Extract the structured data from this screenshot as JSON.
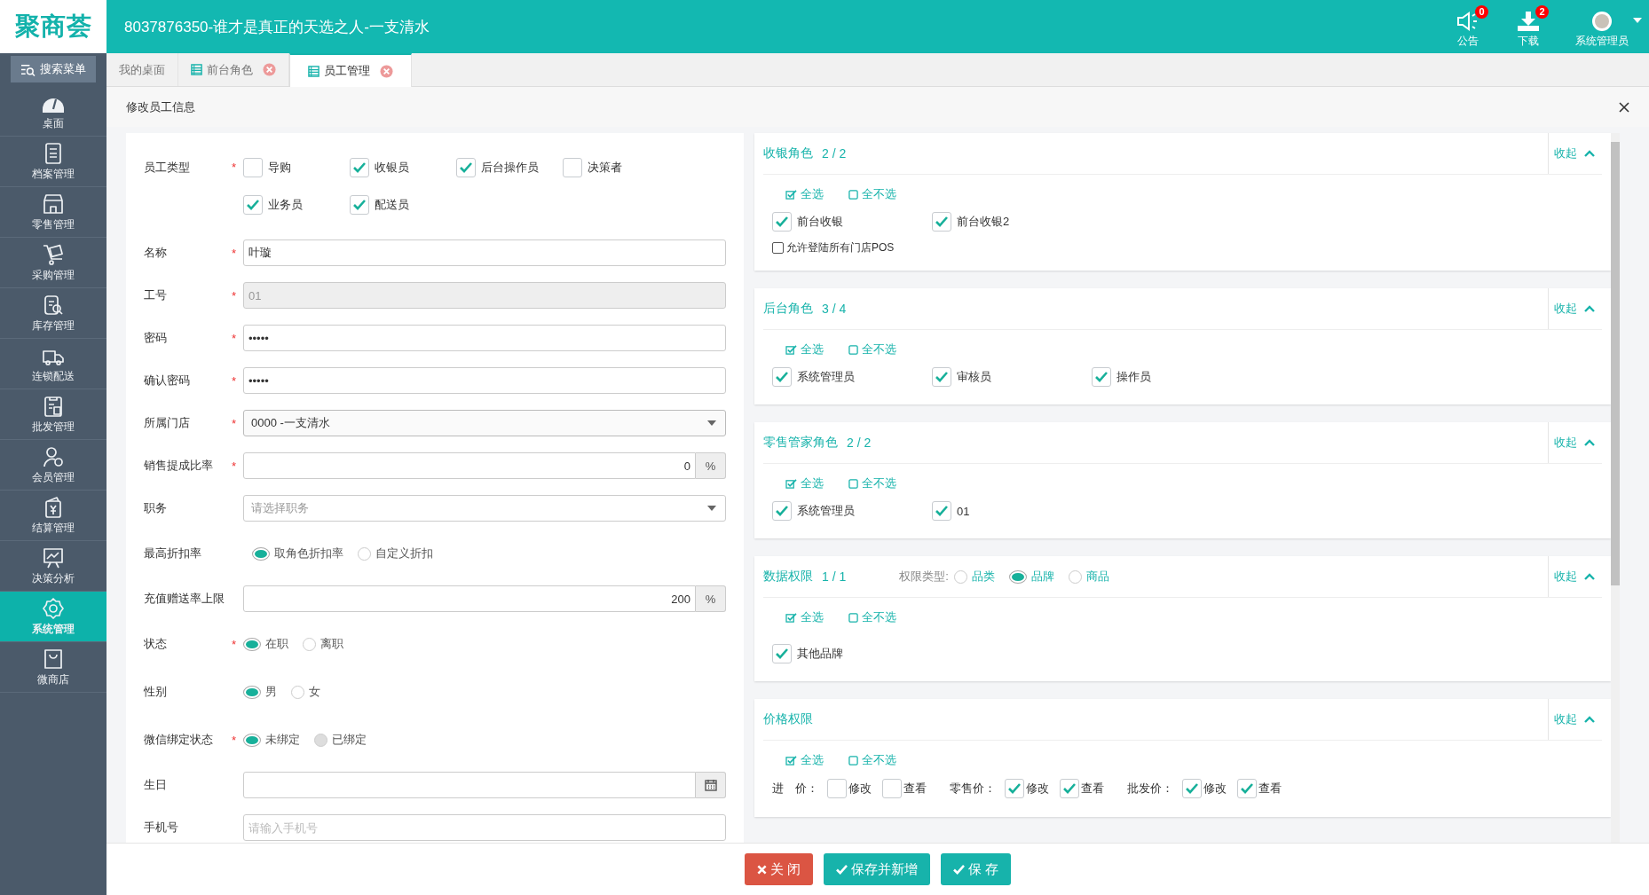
{
  "header": {
    "logo": "聚商荟",
    "title": "8037876350-谁才是真正的天选之人-一支清水",
    "actions": [
      {
        "label": "公告",
        "badge": "0"
      },
      {
        "label": "下载",
        "badge": "2"
      },
      {
        "label": "系统管理员"
      }
    ]
  },
  "sidebar": {
    "search": "搜索菜单",
    "items": [
      {
        "label": "桌面",
        "selected": false
      },
      {
        "label": "档案管理",
        "selected": false
      },
      {
        "label": "零售管理",
        "selected": false
      },
      {
        "label": "采购管理",
        "selected": false
      },
      {
        "label": "库存管理",
        "selected": false
      },
      {
        "label": "连锁配送",
        "selected": false
      },
      {
        "label": "批发管理",
        "selected": false
      },
      {
        "label": "会员管理",
        "selected": false
      },
      {
        "label": "结算管理",
        "selected": false
      },
      {
        "label": "决策分析",
        "selected": false
      },
      {
        "label": "系统管理",
        "selected": true
      },
      {
        "label": "微商店",
        "selected": false
      }
    ]
  },
  "tabs": [
    {
      "label": "我的桌面",
      "selected": false,
      "closable": false
    },
    {
      "label": "前台角色",
      "selected": false,
      "closable": true
    },
    {
      "label": "员工管理",
      "selected": true,
      "closable": true
    }
  ],
  "panel": {
    "title": "修改员工信息"
  },
  "form": {
    "fields": [
      {
        "kind": "checkboxes",
        "label": "员工类型",
        "required_mark": "*",
        "options": [
          {
            "label": "导购",
            "checked": false
          },
          {
            "label": "收银员",
            "checked": true
          },
          {
            "label": "后台操作员",
            "checked": true
          },
          {
            "label": "决策者",
            "checked": false
          },
          {
            "label": "业务员",
            "checked": true
          },
          {
            "label": "配送员",
            "checked": true
          }
        ]
      },
      {
        "kind": "text",
        "label": "名称",
        "required_mark": "*",
        "value": "叶璇",
        "disabled": false
      },
      {
        "kind": "text",
        "label": "工号",
        "required_mark": "*",
        "value": "01",
        "disabled": true
      },
      {
        "kind": "text",
        "label": "密码",
        "required_mark": "*",
        "value": "•••••",
        "disabled": false
      },
      {
        "kind": "text",
        "label": "确认密码",
        "required_mark": "*",
        "value": "•••••",
        "disabled": false
      },
      {
        "kind": "select",
        "label": "所属门店",
        "required_mark": "*",
        "value": "0000 -一支清水"
      },
      {
        "kind": "addon",
        "label": "销售提成比率",
        "required_mark": "*",
        "value": "0",
        "addon": "%"
      },
      {
        "kind": "select",
        "label": "职务",
        "placeholder": "请选择职务"
      },
      {
        "kind": "radios",
        "label": "最高折扣率",
        "options": [
          {
            "label": "取角色折扣率",
            "selected": true,
            "disabled": false
          },
          {
            "label": "自定义折扣",
            "selected": false,
            "disabled": false
          }
        ]
      },
      {
        "kind": "addon",
        "label": "充值赠送率上限",
        "value": "200",
        "addon": "%"
      },
      {
        "kind": "radios",
        "label": "状态",
        "required_mark": "*",
        "options": [
          {
            "label": "在职",
            "selected": true,
            "disabled": false
          },
          {
            "label": "离职",
            "selected": false,
            "disabled": false
          }
        ]
      },
      {
        "kind": "radios",
        "label": "性别",
        "options": [
          {
            "label": "男",
            "selected": true,
            "disabled": false
          },
          {
            "label": "女",
            "selected": false,
            "disabled": false
          }
        ]
      },
      {
        "kind": "radios",
        "label": "微信绑定状态",
        "required_mark": "*",
        "options": [
          {
            "label": "未绑定",
            "selected": true,
            "disabled": false
          },
          {
            "label": "已绑定",
            "selected": false,
            "disabled": true
          }
        ]
      },
      {
        "kind": "date",
        "label": "生日"
      },
      {
        "kind": "text",
        "label": "手机号",
        "placeholder": "请输入手机号",
        "disabled": false
      }
    ]
  },
  "permissions": [
    {
      "title": "收银角色",
      "count": "2 / 2",
      "collapse": "收起",
      "select_all": "全选",
      "select_none": "全不选",
      "options": [
        {
          "label": "前台收银",
          "checked": true
        },
        {
          "label": "前台收银2",
          "checked": true
        }
      ],
      "extra": {
        "label": "允许登陆所有门店POS",
        "checked": false
      }
    },
    {
      "title": "后台角色",
      "count": "3 / 4",
      "collapse": "收起",
      "select_all": "全选",
      "select_none": "全不选",
      "options": [
        {
          "label": "系统管理员",
          "checked": true
        },
        {
          "label": "审核员",
          "checked": true
        },
        {
          "label": "操作员",
          "checked": true
        }
      ]
    },
    {
      "title": "零售管家角色",
      "count": "2 / 2",
      "collapse": "收起",
      "select_all": "全选",
      "select_none": "全不选",
      "options": [
        {
          "label": "系统管理员",
          "checked": true
        },
        {
          "label": "01",
          "checked": true
        }
      ]
    },
    {
      "title": "数据权限",
      "count": "1 / 1",
      "type_label": "权限类型:",
      "types": [
        {
          "label": "品类",
          "selected": false
        },
        {
          "label": "品牌",
          "selected": true
        },
        {
          "label": "商品",
          "selected": false
        }
      ],
      "collapse": "收起",
      "select_all": "全选",
      "select_none": "全不选",
      "options": [
        {
          "label": "其他品牌",
          "checked": true
        }
      ]
    },
    {
      "title": "价格权限",
      "collapse": "收起",
      "select_all": "全选",
      "select_none": "全不选",
      "price_groups": [
        {
          "label": "进　价：",
          "options": [
            {
              "label": "修改",
              "checked": false
            },
            {
              "label": "查看",
              "checked": false
            }
          ]
        },
        {
          "label": "零售价：",
          "options": [
            {
              "label": "修改",
              "checked": true
            },
            {
              "label": "查看",
              "checked": true
            }
          ]
        },
        {
          "label": "批发价：",
          "options": [
            {
              "label": "修改",
              "checked": true
            },
            {
              "label": "查看",
              "checked": true
            }
          ]
        }
      ]
    }
  ],
  "buttons": [
    {
      "label": "关 闭",
      "kind": "danger"
    },
    {
      "label": "保存并新增",
      "kind": "primary"
    },
    {
      "label": "保 存",
      "kind": "primary"
    }
  ]
}
